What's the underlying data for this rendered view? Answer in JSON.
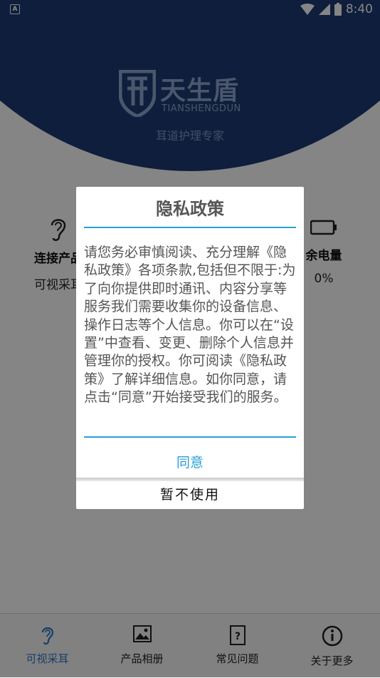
{
  "status": {
    "time": "8:40"
  },
  "brand": {
    "name_cn": "天生盾",
    "name_en": "TIANSHENGDUN",
    "subtitle": "耳道护理专家"
  },
  "stats": {
    "connect_label": "连接产品",
    "connect_value": "可视采耳",
    "battery_label": "余电量",
    "battery_value": "0%"
  },
  "dialog": {
    "title": "隐私政策",
    "body": "请您务必审慎阅读、充分理解《隐私政策》各项条款,包括但不限于:为了向你提供即时通讯、内容分享等服务我们需要收集你的设备信息、操作日志等个人信息。你可以在“设置”中查看、变更、删除个人信息并管理你的授权。你可阅读《隐私政策》了解详细信息。如你同意，请点击“同意”开始接受我们的服务。",
    "agree": "同意",
    "decline": "暂不使用"
  },
  "tabs": [
    {
      "label": "可视采耳",
      "icon": "ear-icon",
      "active": true
    },
    {
      "label": "产品相册",
      "icon": "image-icon",
      "active": false
    },
    {
      "label": "常见问题",
      "icon": "help-document-icon",
      "active": false
    },
    {
      "label": "关于更多",
      "icon": "info-icon",
      "active": false
    }
  ],
  "colors": {
    "header": "#1b3a73",
    "accent": "#2a9fd6",
    "tab_active": "#2b78c5"
  }
}
